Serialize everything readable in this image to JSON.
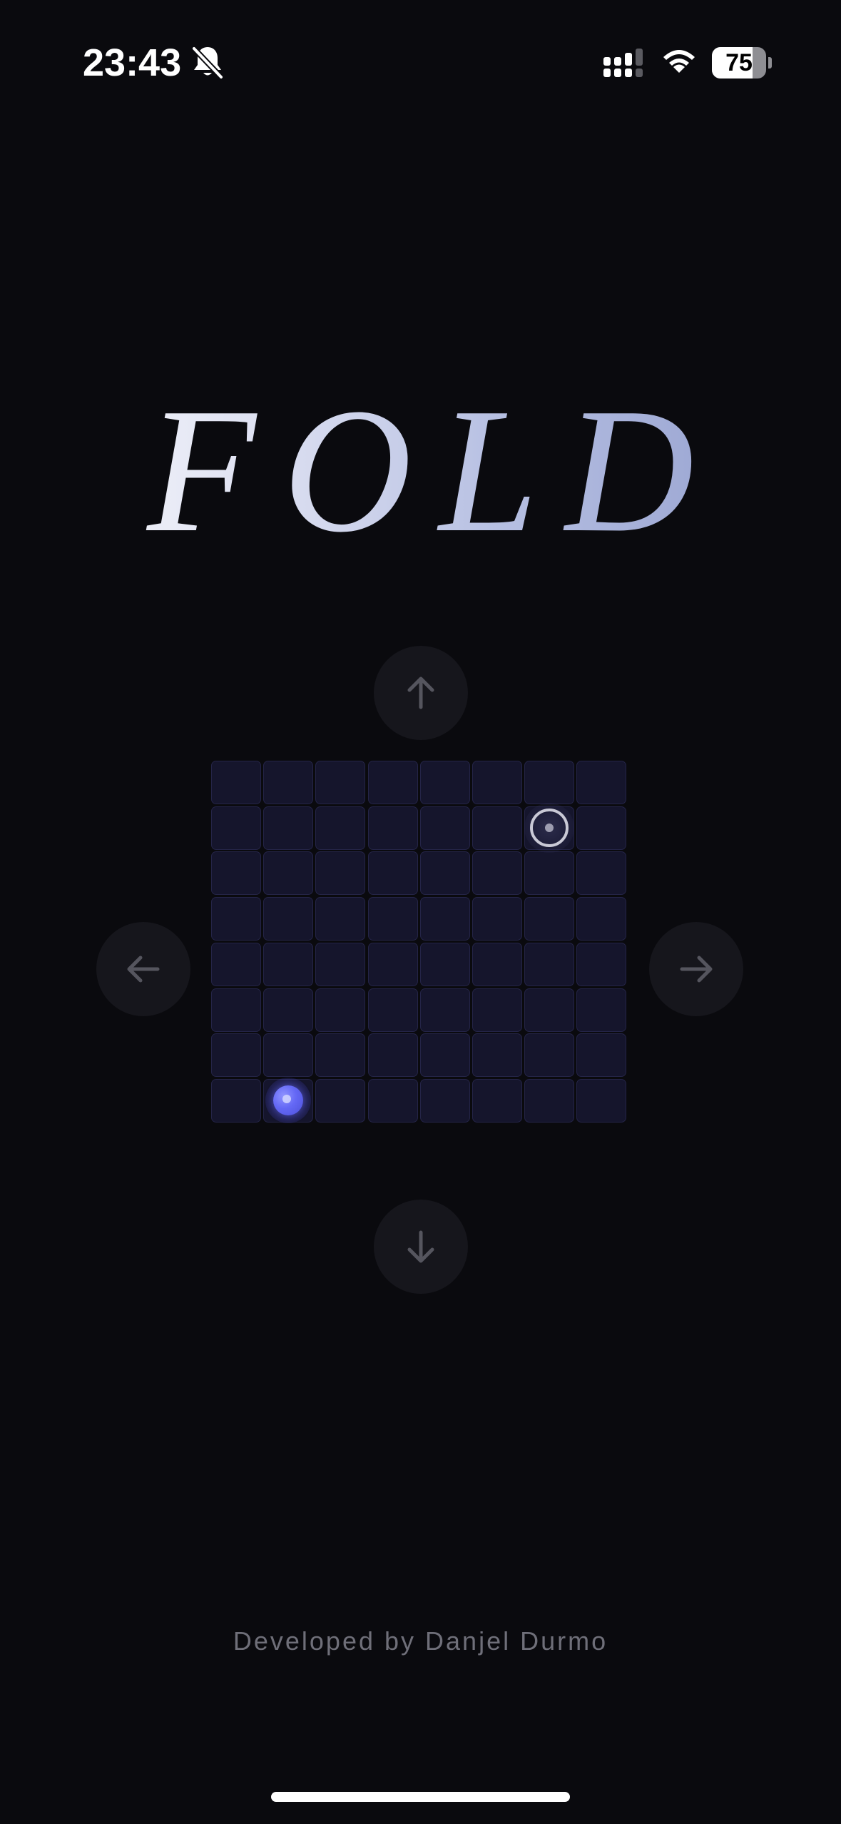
{
  "status_bar": {
    "time": "23:43",
    "battery_level": "75",
    "battery_fraction": 0.75,
    "icons": [
      "bell-slash-icon",
      "cellular-signal-icon",
      "wifi-icon",
      "battery-icon"
    ]
  },
  "title": "FOLD",
  "controls": {
    "icons": [
      "arrow-up-icon",
      "arrow-down-icon",
      "arrow-left-icon",
      "arrow-right-icon"
    ]
  },
  "board": {
    "rows": 8,
    "cols": 8,
    "player": {
      "row": 7,
      "col": 1
    },
    "goal": {
      "row": 1,
      "col": 6
    },
    "colors": {
      "cell": "#15152c",
      "cell_border": "#242447",
      "player": "#6468f5",
      "goal_ring": "#c9c9d6"
    }
  },
  "footer": {
    "credit": "Developed by Danjel Durmo"
  },
  "colors": {
    "background": "#0a0a0e",
    "button": "#16161c",
    "arrow": "#55555e",
    "credit_text": "#6f6f79"
  }
}
